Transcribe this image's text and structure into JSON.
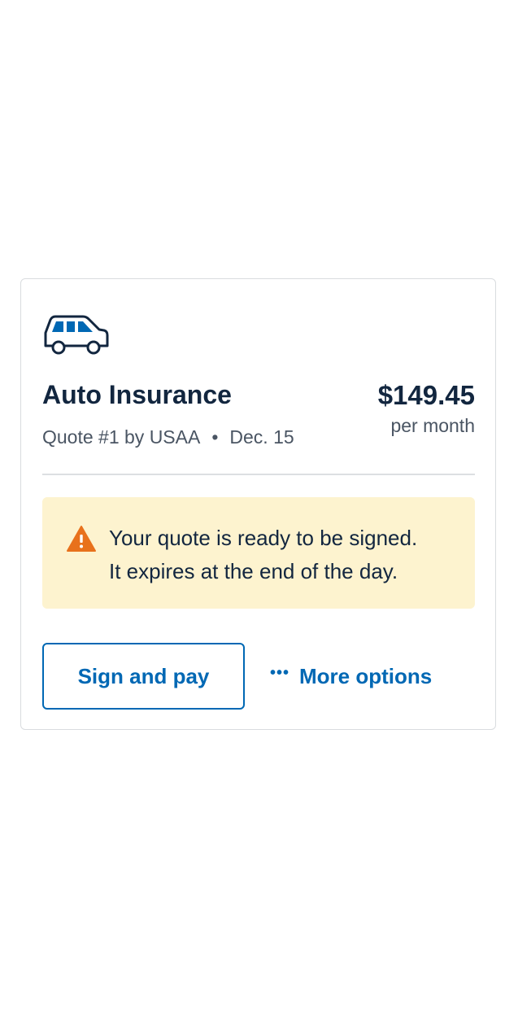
{
  "card": {
    "icon": "car-icon",
    "title": "Auto Insurance",
    "quote_label": "Quote #1 by USAA",
    "separator": "•",
    "date": "Dec. 15",
    "price": "$149.45",
    "period": "per month"
  },
  "alert": {
    "icon": "warning-icon",
    "line1": "Your quote is ready to be signed.",
    "line2": "It expires at the end of the day."
  },
  "actions": {
    "sign_label": "Sign and pay",
    "more_icon": "ellipsis-icon",
    "more_dots": "•••",
    "more_label": "More options"
  },
  "colors": {
    "primary_blue": "#0068b4",
    "heading_navy": "#12263f",
    "warning_orange": "#e8711c",
    "alert_background": "#fdf3cf",
    "muted_text": "#4a5563"
  }
}
